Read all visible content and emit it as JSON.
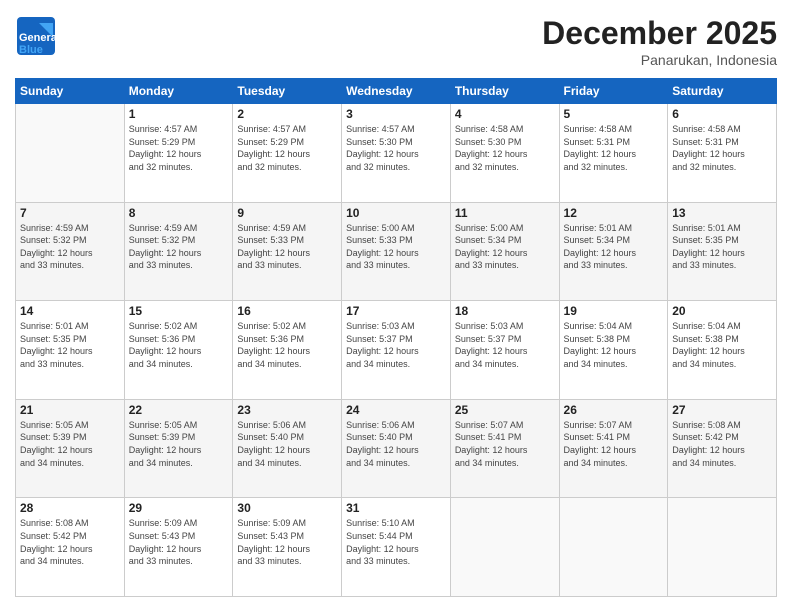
{
  "header": {
    "logo_general": "General",
    "logo_blue": "Blue",
    "month_title": "December 2025",
    "subtitle": "Panarukan, Indonesia"
  },
  "weekdays": [
    "Sunday",
    "Monday",
    "Tuesday",
    "Wednesday",
    "Thursday",
    "Friday",
    "Saturday"
  ],
  "weeks": [
    [
      {
        "day": "",
        "info": ""
      },
      {
        "day": "1",
        "info": "Sunrise: 4:57 AM\nSunset: 5:29 PM\nDaylight: 12 hours\nand 32 minutes."
      },
      {
        "day": "2",
        "info": "Sunrise: 4:57 AM\nSunset: 5:29 PM\nDaylight: 12 hours\nand 32 minutes."
      },
      {
        "day": "3",
        "info": "Sunrise: 4:57 AM\nSunset: 5:30 PM\nDaylight: 12 hours\nand 32 minutes."
      },
      {
        "day": "4",
        "info": "Sunrise: 4:58 AM\nSunset: 5:30 PM\nDaylight: 12 hours\nand 32 minutes."
      },
      {
        "day": "5",
        "info": "Sunrise: 4:58 AM\nSunset: 5:31 PM\nDaylight: 12 hours\nand 32 minutes."
      },
      {
        "day": "6",
        "info": "Sunrise: 4:58 AM\nSunset: 5:31 PM\nDaylight: 12 hours\nand 32 minutes."
      }
    ],
    [
      {
        "day": "7",
        "info": "Sunrise: 4:59 AM\nSunset: 5:32 PM\nDaylight: 12 hours\nand 33 minutes."
      },
      {
        "day": "8",
        "info": "Sunrise: 4:59 AM\nSunset: 5:32 PM\nDaylight: 12 hours\nand 33 minutes."
      },
      {
        "day": "9",
        "info": "Sunrise: 4:59 AM\nSunset: 5:33 PM\nDaylight: 12 hours\nand 33 minutes."
      },
      {
        "day": "10",
        "info": "Sunrise: 5:00 AM\nSunset: 5:33 PM\nDaylight: 12 hours\nand 33 minutes."
      },
      {
        "day": "11",
        "info": "Sunrise: 5:00 AM\nSunset: 5:34 PM\nDaylight: 12 hours\nand 33 minutes."
      },
      {
        "day": "12",
        "info": "Sunrise: 5:01 AM\nSunset: 5:34 PM\nDaylight: 12 hours\nand 33 minutes."
      },
      {
        "day": "13",
        "info": "Sunrise: 5:01 AM\nSunset: 5:35 PM\nDaylight: 12 hours\nand 33 minutes."
      }
    ],
    [
      {
        "day": "14",
        "info": "Sunrise: 5:01 AM\nSunset: 5:35 PM\nDaylight: 12 hours\nand 33 minutes."
      },
      {
        "day": "15",
        "info": "Sunrise: 5:02 AM\nSunset: 5:36 PM\nDaylight: 12 hours\nand 34 minutes."
      },
      {
        "day": "16",
        "info": "Sunrise: 5:02 AM\nSunset: 5:36 PM\nDaylight: 12 hours\nand 34 minutes."
      },
      {
        "day": "17",
        "info": "Sunrise: 5:03 AM\nSunset: 5:37 PM\nDaylight: 12 hours\nand 34 minutes."
      },
      {
        "day": "18",
        "info": "Sunrise: 5:03 AM\nSunset: 5:37 PM\nDaylight: 12 hours\nand 34 minutes."
      },
      {
        "day": "19",
        "info": "Sunrise: 5:04 AM\nSunset: 5:38 PM\nDaylight: 12 hours\nand 34 minutes."
      },
      {
        "day": "20",
        "info": "Sunrise: 5:04 AM\nSunset: 5:38 PM\nDaylight: 12 hours\nand 34 minutes."
      }
    ],
    [
      {
        "day": "21",
        "info": "Sunrise: 5:05 AM\nSunset: 5:39 PM\nDaylight: 12 hours\nand 34 minutes."
      },
      {
        "day": "22",
        "info": "Sunrise: 5:05 AM\nSunset: 5:39 PM\nDaylight: 12 hours\nand 34 minutes."
      },
      {
        "day": "23",
        "info": "Sunrise: 5:06 AM\nSunset: 5:40 PM\nDaylight: 12 hours\nand 34 minutes."
      },
      {
        "day": "24",
        "info": "Sunrise: 5:06 AM\nSunset: 5:40 PM\nDaylight: 12 hours\nand 34 minutes."
      },
      {
        "day": "25",
        "info": "Sunrise: 5:07 AM\nSunset: 5:41 PM\nDaylight: 12 hours\nand 34 minutes."
      },
      {
        "day": "26",
        "info": "Sunrise: 5:07 AM\nSunset: 5:41 PM\nDaylight: 12 hours\nand 34 minutes."
      },
      {
        "day": "27",
        "info": "Sunrise: 5:08 AM\nSunset: 5:42 PM\nDaylight: 12 hours\nand 34 minutes."
      }
    ],
    [
      {
        "day": "28",
        "info": "Sunrise: 5:08 AM\nSunset: 5:42 PM\nDaylight: 12 hours\nand 34 minutes."
      },
      {
        "day": "29",
        "info": "Sunrise: 5:09 AM\nSunset: 5:43 PM\nDaylight: 12 hours\nand 33 minutes."
      },
      {
        "day": "30",
        "info": "Sunrise: 5:09 AM\nSunset: 5:43 PM\nDaylight: 12 hours\nand 33 minutes."
      },
      {
        "day": "31",
        "info": "Sunrise: 5:10 AM\nSunset: 5:44 PM\nDaylight: 12 hours\nand 33 minutes."
      },
      {
        "day": "",
        "info": ""
      },
      {
        "day": "",
        "info": ""
      },
      {
        "day": "",
        "info": ""
      }
    ]
  ]
}
